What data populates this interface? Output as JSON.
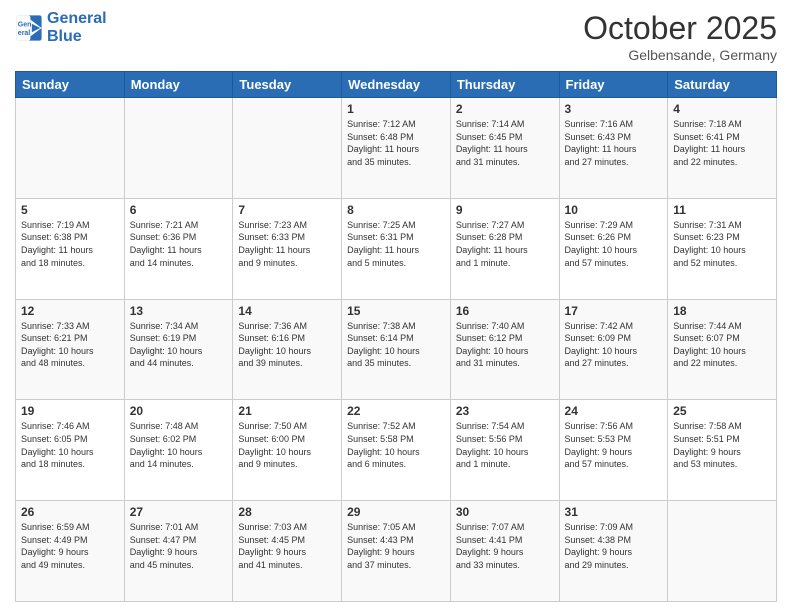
{
  "header": {
    "logo_line1": "General",
    "logo_line2": "Blue",
    "month": "October 2025",
    "location": "Gelbensande, Germany"
  },
  "days_of_week": [
    "Sunday",
    "Monday",
    "Tuesday",
    "Wednesday",
    "Thursday",
    "Friday",
    "Saturday"
  ],
  "weeks": [
    [
      {
        "day": "",
        "info": ""
      },
      {
        "day": "",
        "info": ""
      },
      {
        "day": "",
        "info": ""
      },
      {
        "day": "1",
        "info": "Sunrise: 7:12 AM\nSunset: 6:48 PM\nDaylight: 11 hours\nand 35 minutes."
      },
      {
        "day": "2",
        "info": "Sunrise: 7:14 AM\nSunset: 6:45 PM\nDaylight: 11 hours\nand 31 minutes."
      },
      {
        "day": "3",
        "info": "Sunrise: 7:16 AM\nSunset: 6:43 PM\nDaylight: 11 hours\nand 27 minutes."
      },
      {
        "day": "4",
        "info": "Sunrise: 7:18 AM\nSunset: 6:41 PM\nDaylight: 11 hours\nand 22 minutes."
      }
    ],
    [
      {
        "day": "5",
        "info": "Sunrise: 7:19 AM\nSunset: 6:38 PM\nDaylight: 11 hours\nand 18 minutes."
      },
      {
        "day": "6",
        "info": "Sunrise: 7:21 AM\nSunset: 6:36 PM\nDaylight: 11 hours\nand 14 minutes."
      },
      {
        "day": "7",
        "info": "Sunrise: 7:23 AM\nSunset: 6:33 PM\nDaylight: 11 hours\nand 9 minutes."
      },
      {
        "day": "8",
        "info": "Sunrise: 7:25 AM\nSunset: 6:31 PM\nDaylight: 11 hours\nand 5 minutes."
      },
      {
        "day": "9",
        "info": "Sunrise: 7:27 AM\nSunset: 6:28 PM\nDaylight: 11 hours\nand 1 minute."
      },
      {
        "day": "10",
        "info": "Sunrise: 7:29 AM\nSunset: 6:26 PM\nDaylight: 10 hours\nand 57 minutes."
      },
      {
        "day": "11",
        "info": "Sunrise: 7:31 AM\nSunset: 6:23 PM\nDaylight: 10 hours\nand 52 minutes."
      }
    ],
    [
      {
        "day": "12",
        "info": "Sunrise: 7:33 AM\nSunset: 6:21 PM\nDaylight: 10 hours\nand 48 minutes."
      },
      {
        "day": "13",
        "info": "Sunrise: 7:34 AM\nSunset: 6:19 PM\nDaylight: 10 hours\nand 44 minutes."
      },
      {
        "day": "14",
        "info": "Sunrise: 7:36 AM\nSunset: 6:16 PM\nDaylight: 10 hours\nand 39 minutes."
      },
      {
        "day": "15",
        "info": "Sunrise: 7:38 AM\nSunset: 6:14 PM\nDaylight: 10 hours\nand 35 minutes."
      },
      {
        "day": "16",
        "info": "Sunrise: 7:40 AM\nSunset: 6:12 PM\nDaylight: 10 hours\nand 31 minutes."
      },
      {
        "day": "17",
        "info": "Sunrise: 7:42 AM\nSunset: 6:09 PM\nDaylight: 10 hours\nand 27 minutes."
      },
      {
        "day": "18",
        "info": "Sunrise: 7:44 AM\nSunset: 6:07 PM\nDaylight: 10 hours\nand 22 minutes."
      }
    ],
    [
      {
        "day": "19",
        "info": "Sunrise: 7:46 AM\nSunset: 6:05 PM\nDaylight: 10 hours\nand 18 minutes."
      },
      {
        "day": "20",
        "info": "Sunrise: 7:48 AM\nSunset: 6:02 PM\nDaylight: 10 hours\nand 14 minutes."
      },
      {
        "day": "21",
        "info": "Sunrise: 7:50 AM\nSunset: 6:00 PM\nDaylight: 10 hours\nand 9 minutes."
      },
      {
        "day": "22",
        "info": "Sunrise: 7:52 AM\nSunset: 5:58 PM\nDaylight: 10 hours\nand 6 minutes."
      },
      {
        "day": "23",
        "info": "Sunrise: 7:54 AM\nSunset: 5:56 PM\nDaylight: 10 hours\nand 1 minute."
      },
      {
        "day": "24",
        "info": "Sunrise: 7:56 AM\nSunset: 5:53 PM\nDaylight: 9 hours\nand 57 minutes."
      },
      {
        "day": "25",
        "info": "Sunrise: 7:58 AM\nSunset: 5:51 PM\nDaylight: 9 hours\nand 53 minutes."
      }
    ],
    [
      {
        "day": "26",
        "info": "Sunrise: 6:59 AM\nSunset: 4:49 PM\nDaylight: 9 hours\nand 49 minutes."
      },
      {
        "day": "27",
        "info": "Sunrise: 7:01 AM\nSunset: 4:47 PM\nDaylight: 9 hours\nand 45 minutes."
      },
      {
        "day": "28",
        "info": "Sunrise: 7:03 AM\nSunset: 4:45 PM\nDaylight: 9 hours\nand 41 minutes."
      },
      {
        "day": "29",
        "info": "Sunrise: 7:05 AM\nSunset: 4:43 PM\nDaylight: 9 hours\nand 37 minutes."
      },
      {
        "day": "30",
        "info": "Sunrise: 7:07 AM\nSunset: 4:41 PM\nDaylight: 9 hours\nand 33 minutes."
      },
      {
        "day": "31",
        "info": "Sunrise: 7:09 AM\nSunset: 4:38 PM\nDaylight: 9 hours\nand 29 minutes."
      },
      {
        "day": "",
        "info": ""
      }
    ]
  ]
}
